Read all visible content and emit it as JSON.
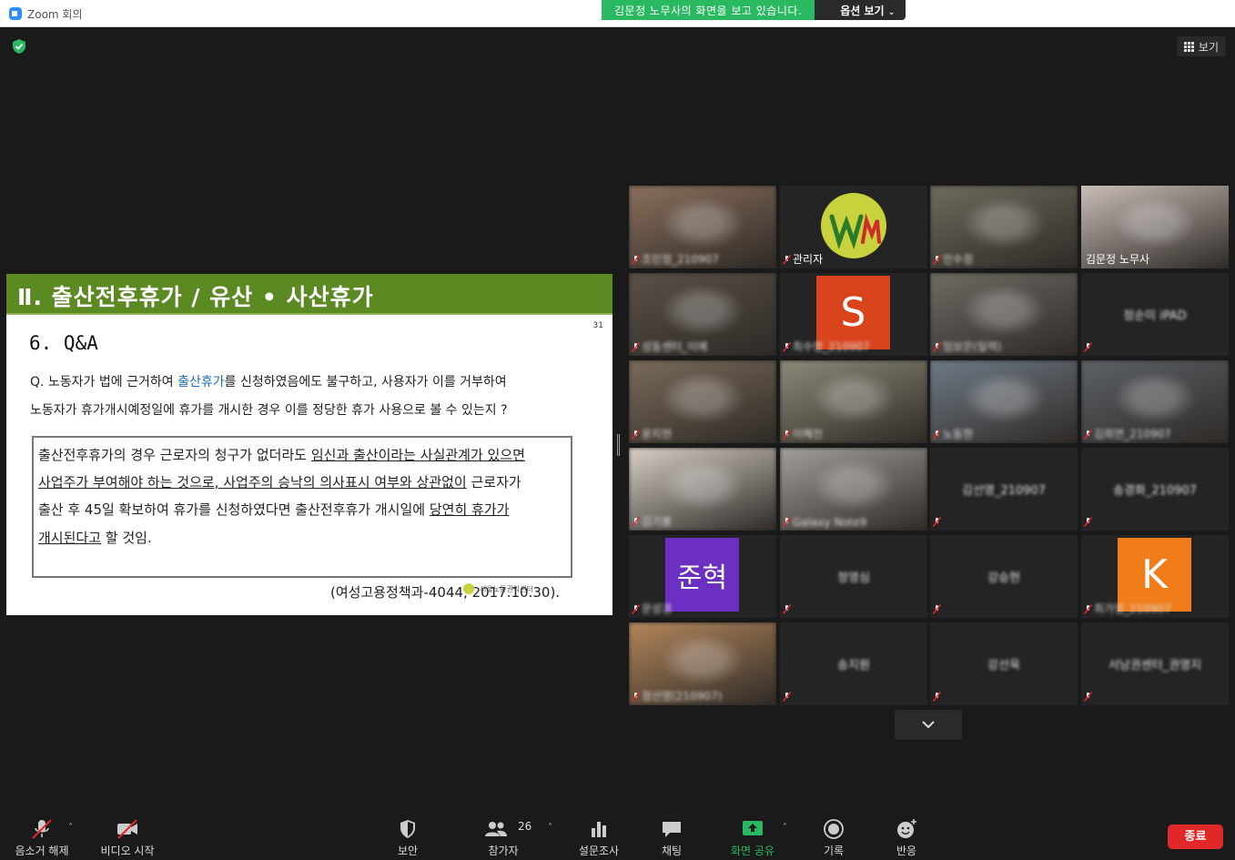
{
  "window": {
    "title": "Zoom 회의"
  },
  "share_banner": {
    "message": "김문정 노무사의 화면을 보고 있습니다.",
    "options_label": "옵션 보기"
  },
  "view_button": {
    "label": "보기"
  },
  "slide": {
    "header": "Ⅱ. 출산전후휴가 / 유산 • 사산휴가",
    "page_number": "31",
    "section": "6. Q&A",
    "question": {
      "line1_a": "Q. 노동자가 법에 근거하여 ",
      "line1_highlight": "출산휴가",
      "line1_b": "를 신청하였음에도 불구하고, 사용자가 이를 거부하여",
      "line2": "노동자가 휴가개시예정일에 휴가를 개시한 경우 이를 정당한 휴가 사용으로 볼 수 있는지 ?"
    },
    "answer": {
      "l1_a": "출산전후휴가의 경우 근로자의 청구가 없더라도 ",
      "l1_u": "임신과 출산이라는 사실관계가 있으면",
      "l2_u": "사업주가 부여해야 하는 것으로, 사업주의 승낙의 의사표시 여부와 상관없이",
      "l2_b": " 근로자가",
      "l3_a": "출산 후 45일 확보하여 휴가를 신청하였다면 출산전후휴가 개시일에 ",
      "l3_u": "당연히 휴가가",
      "l4_u": "개시된다고",
      "l4_b": " 할 것임."
    },
    "citation": "(여성고용정책과-4044, 2017.10.30).",
    "logo_text": "서울노동권익센터"
  },
  "gallery": {
    "tiles": [
      {
        "name": "조민정_210907",
        "kind": "video",
        "bg": "#8a6f5c",
        "blur": true
      },
      {
        "name": "관리자",
        "kind": "logo",
        "bg": "#242424",
        "blur": false
      },
      {
        "name": "민수정",
        "kind": "video",
        "bg": "#6e6a5e",
        "blur": true
      },
      {
        "name": "김문정 노무사",
        "kind": "video",
        "bg": "#c9bdb8",
        "blur": false,
        "active": true
      },
      {
        "name": "성동센터_이예",
        "kind": "video",
        "bg": "#5a5048",
        "blur": true
      },
      {
        "name": "최수영_210907",
        "kind": "avatar",
        "letter": "S",
        "avatar_color": "#d9441c",
        "blur": true
      },
      {
        "name": "임보은(일력)",
        "kind": "video",
        "bg": "#6f6a64",
        "blur": true
      },
      {
        "name": "",
        "center": "정순미 iPAD",
        "kind": "name",
        "blur": true
      },
      {
        "name": "윤지현",
        "kind": "video",
        "bg": "#7b6b5a",
        "blur": true
      },
      {
        "name": "이혜진",
        "kind": "video",
        "bg": "#8d8a79",
        "blur": true
      },
      {
        "name": "노동현",
        "kind": "video",
        "bg": "#6f7a86",
        "blur": true
      },
      {
        "name": "김희연_210907",
        "kind": "video",
        "bg": "#5c6268",
        "blur": true
      },
      {
        "name": "김기봉",
        "kind": "video",
        "bg": "#d8d0c8",
        "blur": true
      },
      {
        "name": "Galaxy Note9",
        "kind": "video",
        "bg": "#a39f9a",
        "blur": true
      },
      {
        "name": "",
        "center": "김선영_210907",
        "kind": "name",
        "blur": true
      },
      {
        "name": "",
        "center": "송경화_210907",
        "kind": "name",
        "blur": true
      },
      {
        "name": "문성경",
        "kind": "avatar",
        "letter": "준혁",
        "avatar_color": "#6b2fc2",
        "blur": true
      },
      {
        "name": "",
        "center": "정영심",
        "kind": "name",
        "blur": true
      },
      {
        "name": "",
        "center": "강승현",
        "kind": "name",
        "blur": true
      },
      {
        "name": "최가영_210907",
        "kind": "avatar",
        "letter": "K",
        "avatar_color": "#f07d1a",
        "blur": true
      },
      {
        "name": "정선영(210907)",
        "kind": "video",
        "bg": "#b4865b",
        "blur": true
      },
      {
        "name": "",
        "center": "송지원",
        "kind": "name",
        "blur": true
      },
      {
        "name": "",
        "center": "강선욱",
        "kind": "name",
        "blur": true
      },
      {
        "name": "",
        "center": "서남권센터_권영지",
        "kind": "name",
        "blur": true
      }
    ]
  },
  "toolbar": {
    "unmute": "음소거 해제",
    "start_video": "비디오 시작",
    "security": "보안",
    "participants": "참가자",
    "participants_count": "26",
    "polls": "설문조사",
    "chat": "채팅",
    "share_screen": "화면 공유",
    "record": "기록",
    "reactions": "반응",
    "end": "종료"
  },
  "colors": {
    "slide_band": "#5b8a23",
    "active_speaker": "#f6ff79",
    "share_green": "#2ab860",
    "end_red": "#e02828"
  }
}
